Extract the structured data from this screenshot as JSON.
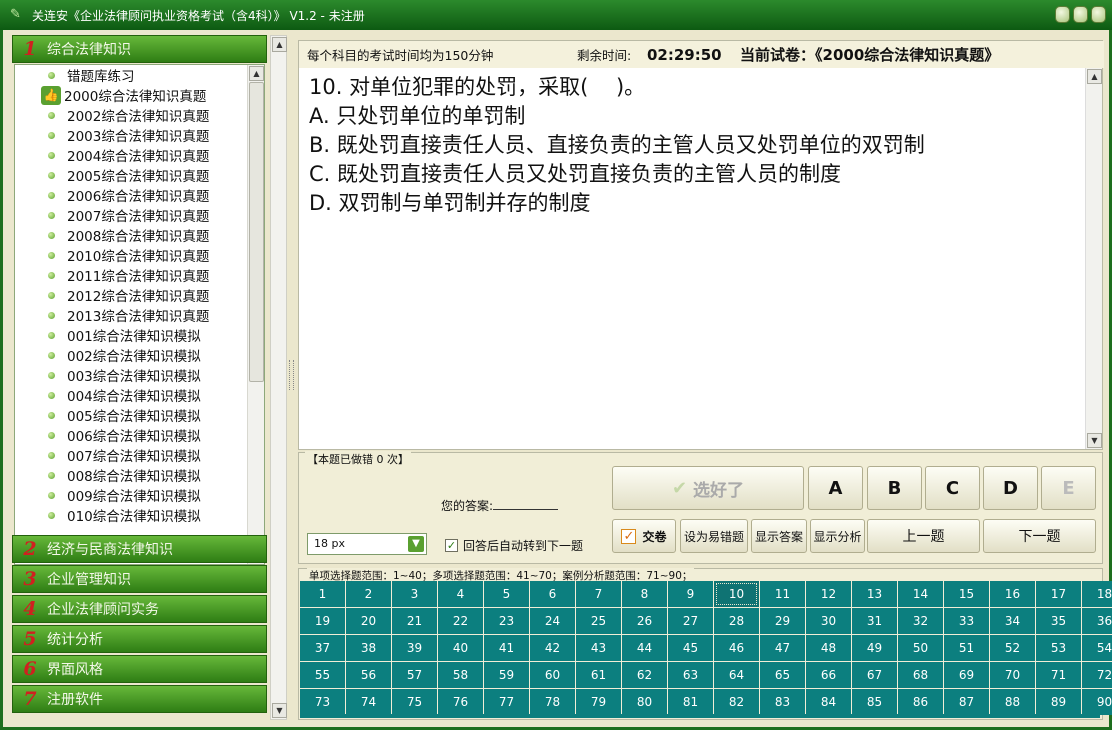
{
  "window": {
    "title": "关连安《企业法律顾问执业资格考试（含4科）》 V1.2 - 未注册"
  },
  "sidebar": {
    "categories": [
      {
        "num": "1",
        "label": "综合法律知识"
      },
      {
        "num": "2",
        "label": "经济与民商法律知识"
      },
      {
        "num": "3",
        "label": "企业管理知识"
      },
      {
        "num": "4",
        "label": "企业法律顾问实务"
      },
      {
        "num": "5",
        "label": "统计分析"
      },
      {
        "num": "6",
        "label": "界面风格"
      },
      {
        "num": "7",
        "label": "注册软件"
      }
    ],
    "tree_items": [
      "错题库练习",
      "2000综合法律知识真题",
      "2002综合法律知识真题",
      "2003综合法律知识真题",
      "2004综合法律知识真题",
      "2005综合法律知识真题",
      "2006综合法律知识真题",
      "2007综合法律知识真题",
      "2008综合法律知识真题",
      "2010综合法律知识真题",
      "2011综合法律知识真题",
      "2012综合法律知识真题",
      "2013综合法律知识真题",
      "001综合法律知识模拟",
      "002综合法律知识模拟",
      "003综合法律知识模拟",
      "004综合法律知识模拟",
      "005综合法律知识模拟",
      "006综合法律知识模拟",
      "007综合法律知识模拟",
      "008综合法律知识模拟",
      "009综合法律知识模拟",
      "010综合法律知识模拟"
    ],
    "selected_index": 1
  },
  "exam": {
    "time_note": "每个科目的考试时间均为150分钟",
    "remaining_label": "剩余时间:",
    "remaining_time": "02:29:50",
    "paper_label": "当前试卷：",
    "paper_name": "《2000综合法律知识真题》"
  },
  "question": {
    "stem": "10. 对单位犯罪的处罚，采取(　 )。",
    "options": [
      "A. 只处罚单位的单罚制",
      "B. 既处罚直接责任人员、直接负责的主管人员又处罚单位的双罚制",
      "C. 既处罚直接责任人员又处罚直接负责的主管人员的制度",
      "D. 双罚制与单罚制并存的制度"
    ]
  },
  "controls": {
    "wrong_count_legend": "【本题已做错 0 次】",
    "your_answer_label": "您的答案:",
    "font_size_value": "18 px",
    "auto_next_label": "回答后自动转到下一题",
    "auto_next_checked": true,
    "confirm_label": "选好了",
    "choice_buttons": [
      "A",
      "B",
      "C",
      "D",
      "E"
    ],
    "submit_label": "交卷",
    "mark_wrong_label": "设为易错题",
    "show_answer_label": "显示答案",
    "show_analysis_label": "显示分析",
    "prev_label": "上一题",
    "next_label": "下一题"
  },
  "navigator": {
    "legend": "单项选择题范围：1~40；多项选择题范围：41~70；案例分析题范围：71~90；",
    "count": 90,
    "current": 10
  }
}
